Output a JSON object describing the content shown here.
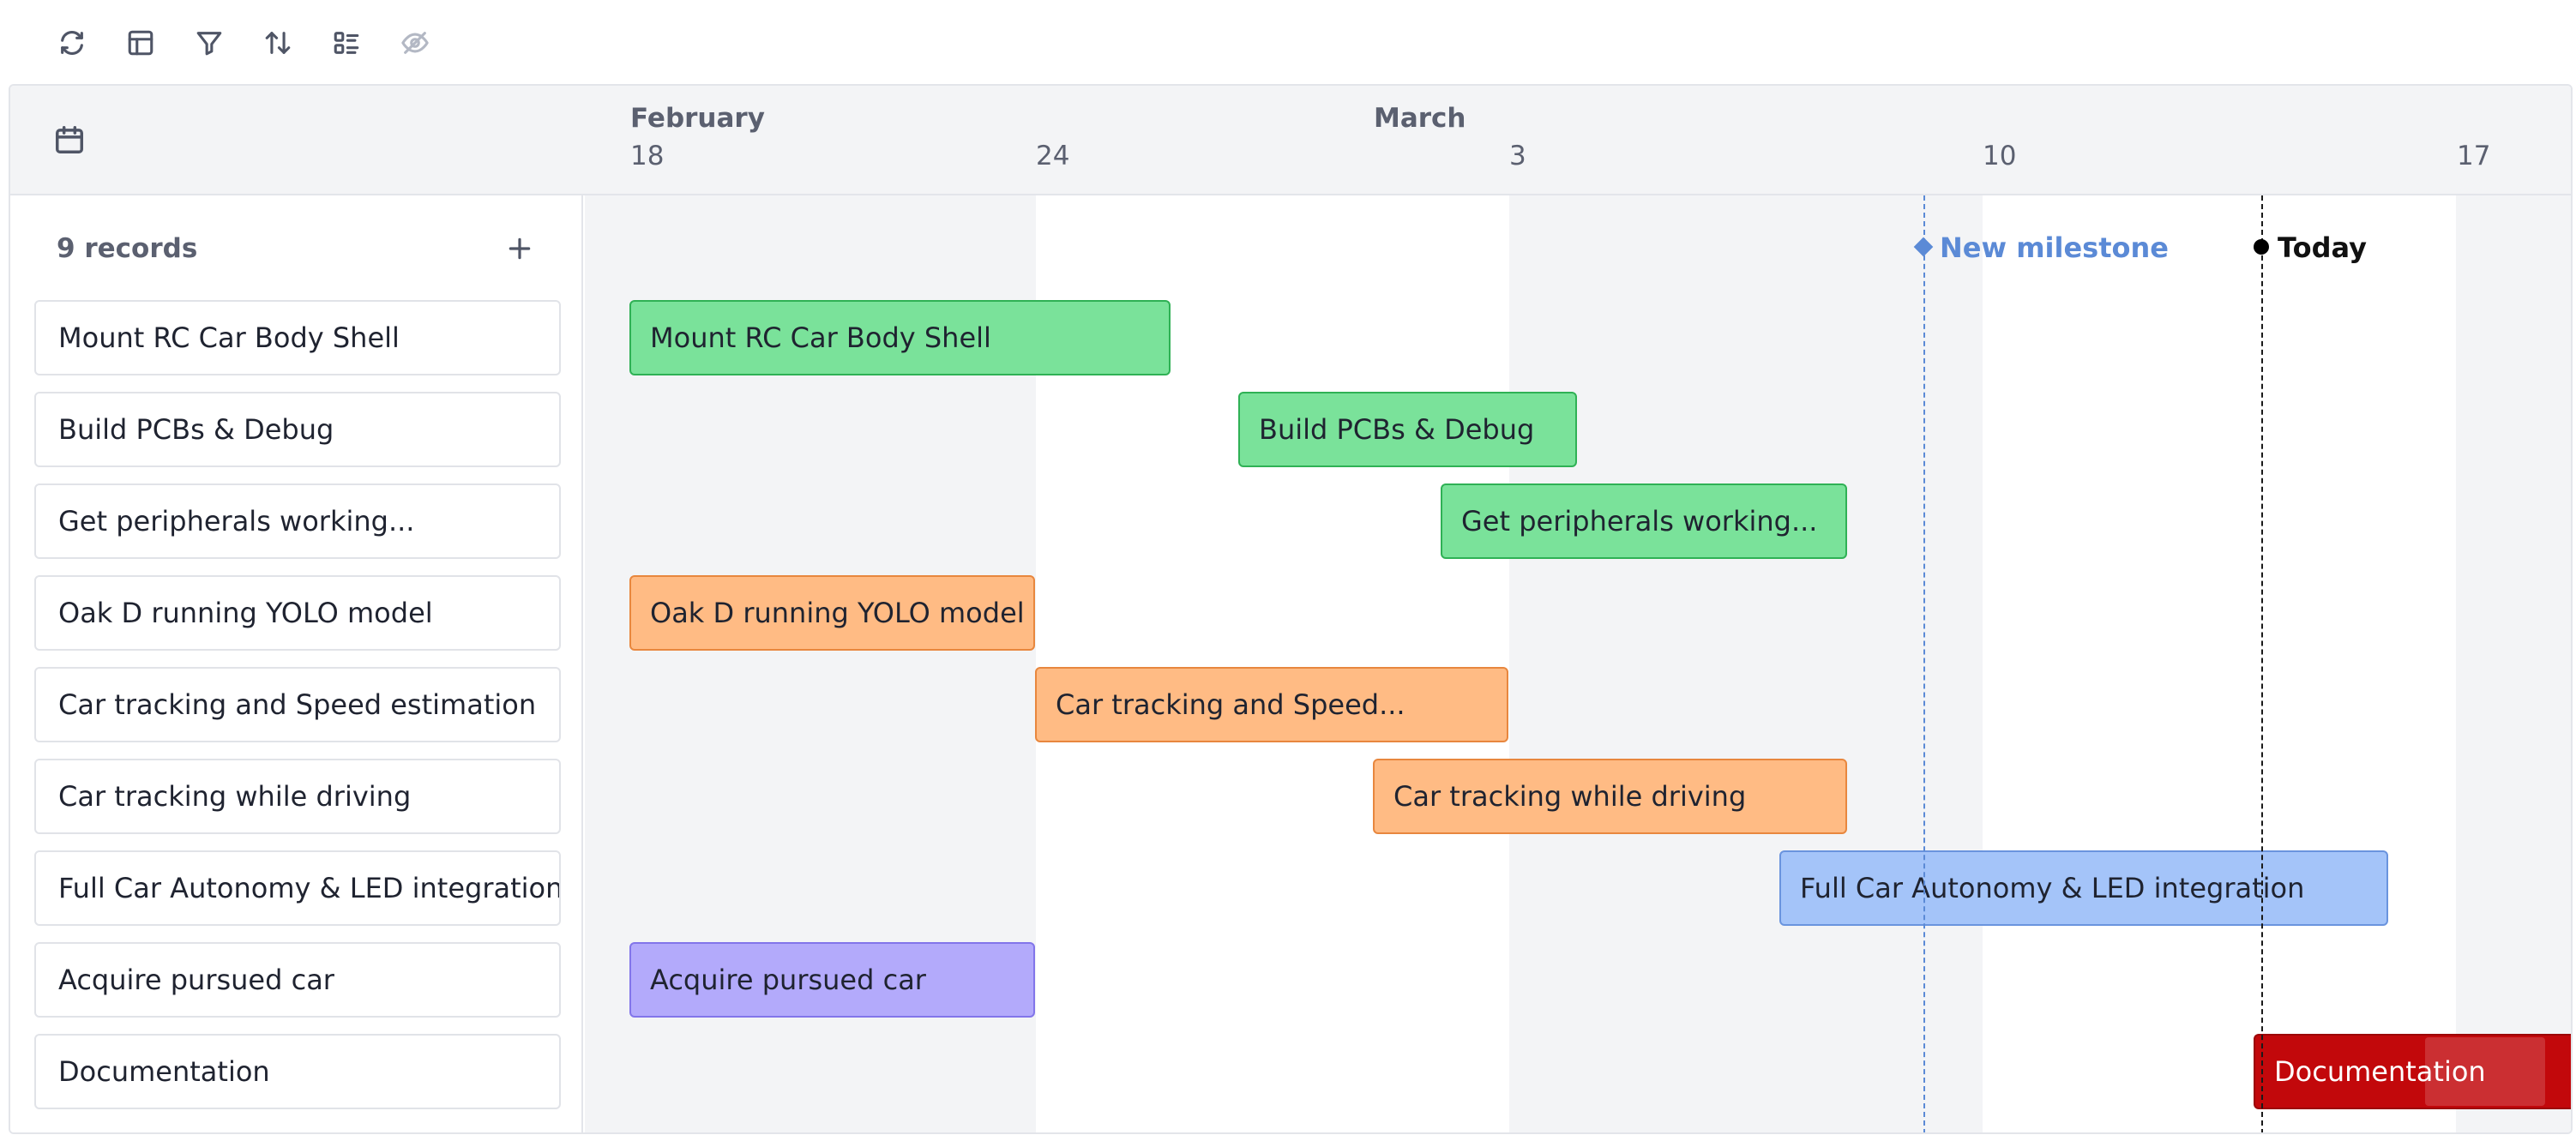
{
  "toolbar": {
    "buttons": [
      {
        "name": "refresh-icon"
      },
      {
        "name": "layout-icon"
      },
      {
        "name": "filter-icon"
      },
      {
        "name": "sort-icon"
      },
      {
        "name": "group-list-icon"
      },
      {
        "name": "hidden-eye-icon",
        "disabled": true
      }
    ]
  },
  "timeline_header": {
    "icon": "calendar-icon",
    "months": [
      "February",
      "March"
    ],
    "days": [
      "18",
      "24",
      "3",
      "10",
      "17"
    ]
  },
  "records": {
    "count_label": "9 records",
    "add_icon": "plus-icon",
    "items": [
      "Mount RC Car Body Shell",
      "Build PCBs & Debug",
      "Get peripherals working...",
      "Oak D running YOLO model",
      "Car tracking and Speed estimation",
      "Car tracking while driving",
      "Full Car Autonomy & LED integration",
      "Acquire pursued car",
      "Documentation"
    ]
  },
  "bars": [
    {
      "label": "Mount RC Car Body Shell",
      "color": "green"
    },
    {
      "label": "Build PCBs & Debug",
      "color": "green"
    },
    {
      "label": "Get peripherals working...",
      "color": "green"
    },
    {
      "label": "Oak D running YOLO model",
      "color": "orange"
    },
    {
      "label": "Car tracking and Speed...",
      "color": "orange"
    },
    {
      "label": "Car tracking while driving",
      "color": "orange"
    },
    {
      "label": "Full Car Autonomy & LED integration",
      "color": "blue"
    },
    {
      "label": "Acquire pursued car",
      "color": "purple"
    },
    {
      "label": "Documentation",
      "color": "red"
    }
  ],
  "markers": {
    "milestone": "New milestone",
    "today": "Today"
  },
  "colors": {
    "green_fill": "#7ae29a",
    "green_border": "#2fb155",
    "orange_fill": "#ffbb84",
    "orange_border": "#e8873e",
    "blue_fill": "#a4c4f9",
    "blue_border": "#6a94de",
    "purple_fill": "#b3aafb",
    "purple_border": "#8275ea",
    "red_fill": "#c2080b",
    "red_border": "#9c0608",
    "milestone": "#5b8ad6"
  }
}
